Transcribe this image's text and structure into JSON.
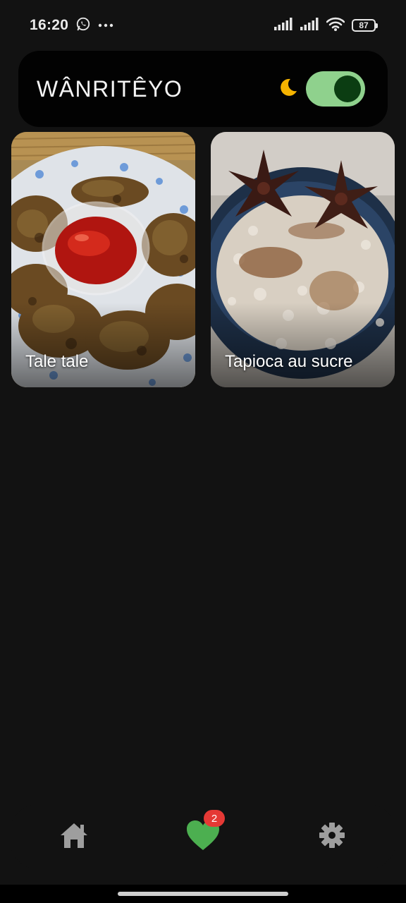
{
  "status_bar": {
    "time": "16:20",
    "battery": "87",
    "icons": [
      "whatsapp-icon",
      "more-dots-icon",
      "signal-icon",
      "signal-icon",
      "wifi-icon",
      "battery-icon"
    ]
  },
  "app_bar": {
    "title": "WÂNRITÊYO",
    "theme_icon": "moon-icon",
    "moon_color": "#f5b300",
    "dark_mode_toggle": {
      "on": true,
      "track_color": "#8fd18d",
      "knob_color": "#0b3d12"
    }
  },
  "recipes": [
    {
      "name": "Tale tale",
      "image": "fritters-with-ketchup"
    },
    {
      "name": "Tapioca au sucre",
      "image": "tapioca-with-star-anise"
    }
  ],
  "bottom_nav": {
    "items": [
      {
        "icon": "home-icon",
        "active": false
      },
      {
        "icon": "heart-icon",
        "active": true,
        "badge": "2"
      },
      {
        "icon": "gear-icon",
        "active": false
      }
    ],
    "active_color": "#4caf50",
    "inactive_color": "#9e9e9e",
    "badge_color": "#e53935"
  }
}
